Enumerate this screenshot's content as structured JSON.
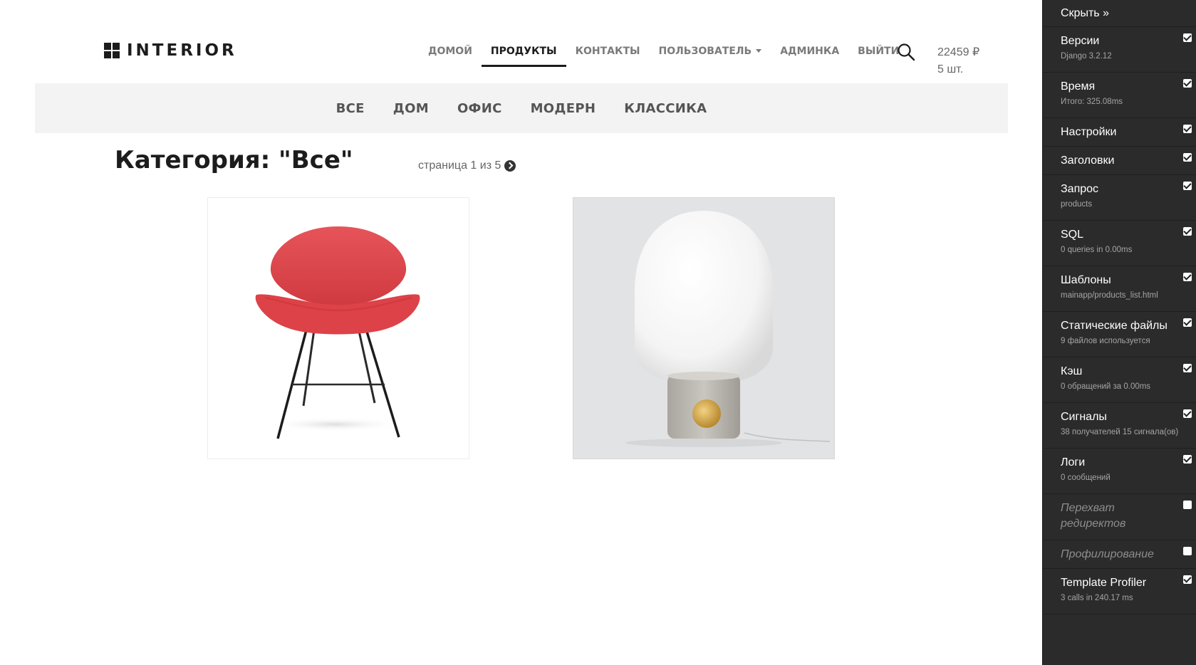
{
  "header": {
    "logo_text": "INTERIOR",
    "nav": [
      {
        "label": "ДОМОЙ"
      },
      {
        "label": "ПРОДУКТЫ"
      },
      {
        "label": "КОНТАКТЫ"
      },
      {
        "label": "ПОЛЬЗОВАТЕЛЬ"
      },
      {
        "label": "АДМИНКА"
      },
      {
        "label": "ВЫЙТИ"
      }
    ],
    "active_nav": "ПРОДУКТЫ",
    "cart": {
      "total": "22459 ₽",
      "count": "5 шт."
    }
  },
  "categories": [
    {
      "label": "ВСЕ"
    },
    {
      "label": "ДОМ"
    },
    {
      "label": "ОФИС"
    },
    {
      "label": "МОДЕРН"
    },
    {
      "label": "КЛАССИКА"
    }
  ],
  "main": {
    "title": "Категория: \"Все\"",
    "pager": "страница 1 из 5"
  },
  "products": [
    {
      "image": "red-chair"
    },
    {
      "image": "globe-table-lamp"
    }
  ],
  "debug_toolbar": {
    "hide_label": "Скрыть »",
    "panels": [
      {
        "title": "Версии",
        "sub": "Django 3.2.12",
        "checked": true
      },
      {
        "title": "Время",
        "sub": "Итого: 325.08ms",
        "checked": true
      },
      {
        "title": "Настройки",
        "sub": "",
        "checked": true
      },
      {
        "title": "Заголовки",
        "sub": "",
        "checked": true
      },
      {
        "title": "Запрос",
        "sub": "products",
        "checked": true
      },
      {
        "title": "SQL",
        "sub": "0 queries in 0.00ms",
        "checked": true
      },
      {
        "title": "Шаблоны",
        "sub": "mainapp/products_list.html",
        "checked": true
      },
      {
        "title": "Статические файлы",
        "sub": "9 файлов используется",
        "checked": true
      },
      {
        "title": "Кэш",
        "sub": "0 обращений за 0.00ms",
        "checked": true
      },
      {
        "title": "Сигналы",
        "sub": "38 получателей 15 сигнала(ов)",
        "checked": true
      },
      {
        "title": "Логи",
        "sub": "0 сообщений",
        "checked": true
      },
      {
        "title": "Перехват редиректов",
        "sub": "",
        "checked": false
      },
      {
        "title": "Профилирование",
        "sub": "",
        "checked": false
      },
      {
        "title": "Template Profiler",
        "sub": "3 calls in 240.17 ms",
        "checked": true
      }
    ]
  },
  "colors": {
    "toolbar_bg": "#2b2b2b",
    "category_bar_bg": "#f3f3f3",
    "product_red": "#e0454a"
  }
}
